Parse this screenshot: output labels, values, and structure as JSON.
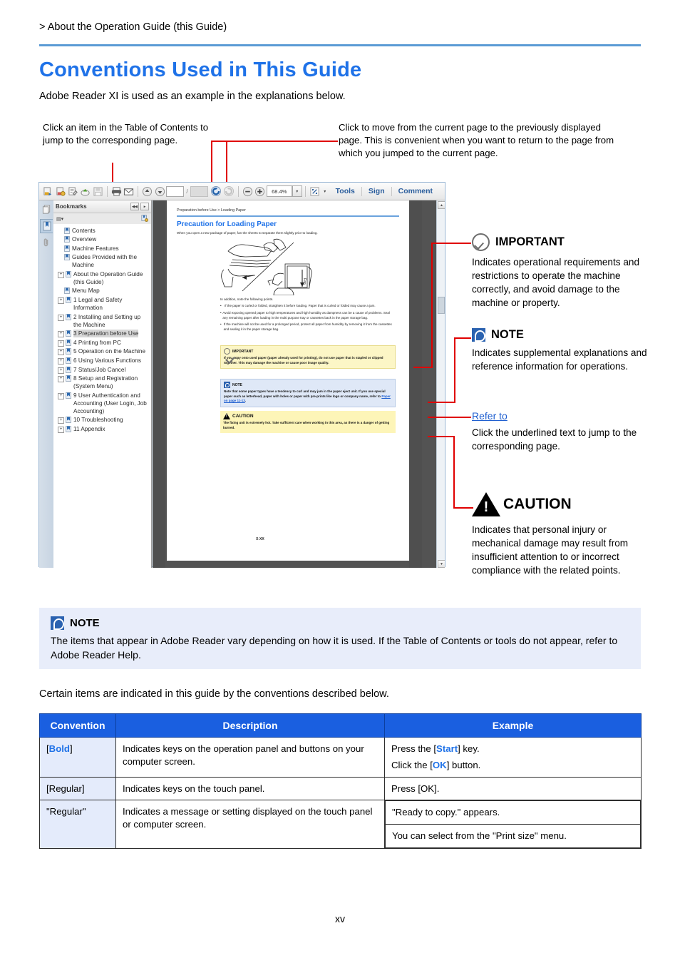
{
  "header": {
    "breadcrumb": "> About the Operation Guide (this Guide)",
    "title": "Conventions Used in This Guide",
    "subtitle": "Adobe Reader XI is used as an example in the explanations below."
  },
  "annotations": {
    "top_left": "Click an item in the Table of Contents to jump to the corresponding page.",
    "top_right": "Click to move from the current page to the previously displayed page. This is convenient when you want to return to the page from which you jumped to the current page."
  },
  "reader": {
    "toolbar": {
      "icons": [
        "save-a-copy-icon",
        "secure-icon",
        "sign-document-icon",
        "share-cloud-icon",
        "save-icon",
        "print-icon",
        "email-icon",
        "previous-page-icon",
        "next-page-icon",
        "back-view-icon",
        "forward-view-icon",
        "zoom-out-icon",
        "zoom-in-icon",
        "fit-page-icon"
      ],
      "page_field": "",
      "page_total": "",
      "zoom_level": "68.4%",
      "tools": "Tools",
      "sign": "Sign",
      "comment": "Comment"
    },
    "rail": [
      "page-thumbnails-icon",
      "bookmarks-icon",
      "attachments-icon"
    ],
    "bookmarks_panel": {
      "title": "Bookmarks",
      "items": [
        {
          "label": "Contents",
          "expandable": false,
          "selected": false
        },
        {
          "label": "Overview",
          "expandable": false,
          "selected": false
        },
        {
          "label": "Machine Features",
          "expandable": false,
          "selected": false
        },
        {
          "label": "Guides Provided with the Machine",
          "expandable": false,
          "selected": false
        },
        {
          "label": "About the Operation Guide (this Guide)",
          "expandable": true,
          "selected": false
        },
        {
          "label": "Menu Map",
          "expandable": false,
          "selected": false
        },
        {
          "label": "1 Legal and Safety Information",
          "expandable": true,
          "selected": false
        },
        {
          "label": "2 Installing and Setting up the Machine",
          "expandable": true,
          "selected": false
        },
        {
          "label": "3 Preparation before Use",
          "expandable": true,
          "selected": true
        },
        {
          "label": "4 Printing from PC",
          "expandable": true,
          "selected": false
        },
        {
          "label": "5 Operation on the Machine",
          "expandable": true,
          "selected": false
        },
        {
          "label": "6 Using Various Functions",
          "expandable": true,
          "selected": false
        },
        {
          "label": "7 Status/Job Cancel",
          "expandable": true,
          "selected": false
        },
        {
          "label": "8 Setup and Registration (System Menu)",
          "expandable": true,
          "selected": false
        },
        {
          "label": "9 User Authentication and Accounting (User Login, Job Accounting)",
          "expandable": true,
          "selected": false
        },
        {
          "label": "10 Troubleshooting",
          "expandable": true,
          "selected": false
        },
        {
          "label": "11 Appendix",
          "expandable": true,
          "selected": false
        }
      ]
    },
    "document": {
      "crumb": "Preparation before Use > Loading Paper",
      "heading": "Precaution for Loading Paper",
      "lead": "When you open a new package of paper, fan the sheets to separate them slightly prior to loading.",
      "note_lead": "In addition, note the following points.",
      "bullets": [
        "If the paper is curled or folded, straighten it before loading. Paper that is curled or folded may cause a jam.",
        "Avoid exposing opened paper to high temperatures and high humidity as dampness can be a cause of problems. Seal any remaining paper after loading in the multi purpose tray or cassettes back in the paper storage bag.",
        "If the machine will not be used for a prolonged period, protect all paper from humidity by removing it from the cassettes and sealing it in the paper storage bag."
      ],
      "important_box": {
        "title": "IMPORTANT",
        "body": "If you copy onto used paper (paper already used for printing), do not use paper that is stapled or clipped together. This may damage the machine or cause poor image quality."
      },
      "note_box": {
        "title": "NOTE",
        "body": "Note that some paper types have a tendency to curl and may jam in the paper eject unit. If you use special paper such as letterhead, paper with holes or paper with pre-prints like logo or company name, refer to ",
        "link": "Paper on page 11-13",
        "body_tail": "."
      },
      "caution_box": {
        "title": "CAUTION",
        "body": "The fixing unit is extremely hot. Take sufficient care when working in this area, as there is a danger of getting burned."
      },
      "footer": "X-XX"
    }
  },
  "legend": {
    "important": {
      "title": "IMPORTANT",
      "body": "Indicates operational requirements and restrictions to operate the machine correctly, and avoid damage to the machine or property."
    },
    "note": {
      "title": "NOTE",
      "body": "Indicates supplemental explanations and reference information for operations."
    },
    "refer": {
      "title": "Refer to",
      "body": "Click the underlined text to jump to the corresponding page."
    },
    "caution": {
      "title": "CAUTION",
      "body": "Indicates that personal injury or mechanical damage may result from insufficient attention to or incorrect compliance with the related points."
    }
  },
  "note_bar": {
    "title": "NOTE",
    "body": "The items that appear in Adobe Reader vary depending on how it is used. If the Table of Contents or tools do not appear, refer to Adobe Reader Help."
  },
  "table_section": {
    "lead": "Certain items are indicated in this guide by the conventions described below.",
    "headers": [
      "Convention",
      "Description",
      "Example"
    ],
    "rows": [
      {
        "convention_pre": "[",
        "convention_bold": "Bold",
        "convention_post": "]",
        "description": "Indicates keys on the operation panel and buttons on your computer screen.",
        "examples": [
          {
            "pre": "Press the [",
            "bold": "Start",
            "post": "] key."
          },
          {
            "pre": "Click the [",
            "bold": "OK",
            "post": "] button."
          }
        ]
      },
      {
        "convention_plain": "[Regular]",
        "description": "Indicates keys on the touch panel.",
        "examples_plain": [
          "Press [OK]."
        ]
      },
      {
        "convention_plain": "\"Regular\"",
        "description": "Indicates a message or setting displayed on the touch panel or computer screen.",
        "examples_plain": [
          "\"Ready to copy.\" appears.",
          "You can select from the \"Print size\" menu."
        ]
      }
    ]
  },
  "folio": "xv",
  "colors": {
    "accent_blue": "#1f72e8",
    "rule_blue": "#5b9bd5",
    "leader_red": "#e00000",
    "table_header": "#1a5fe0",
    "note_bg": "#e8edfa"
  }
}
